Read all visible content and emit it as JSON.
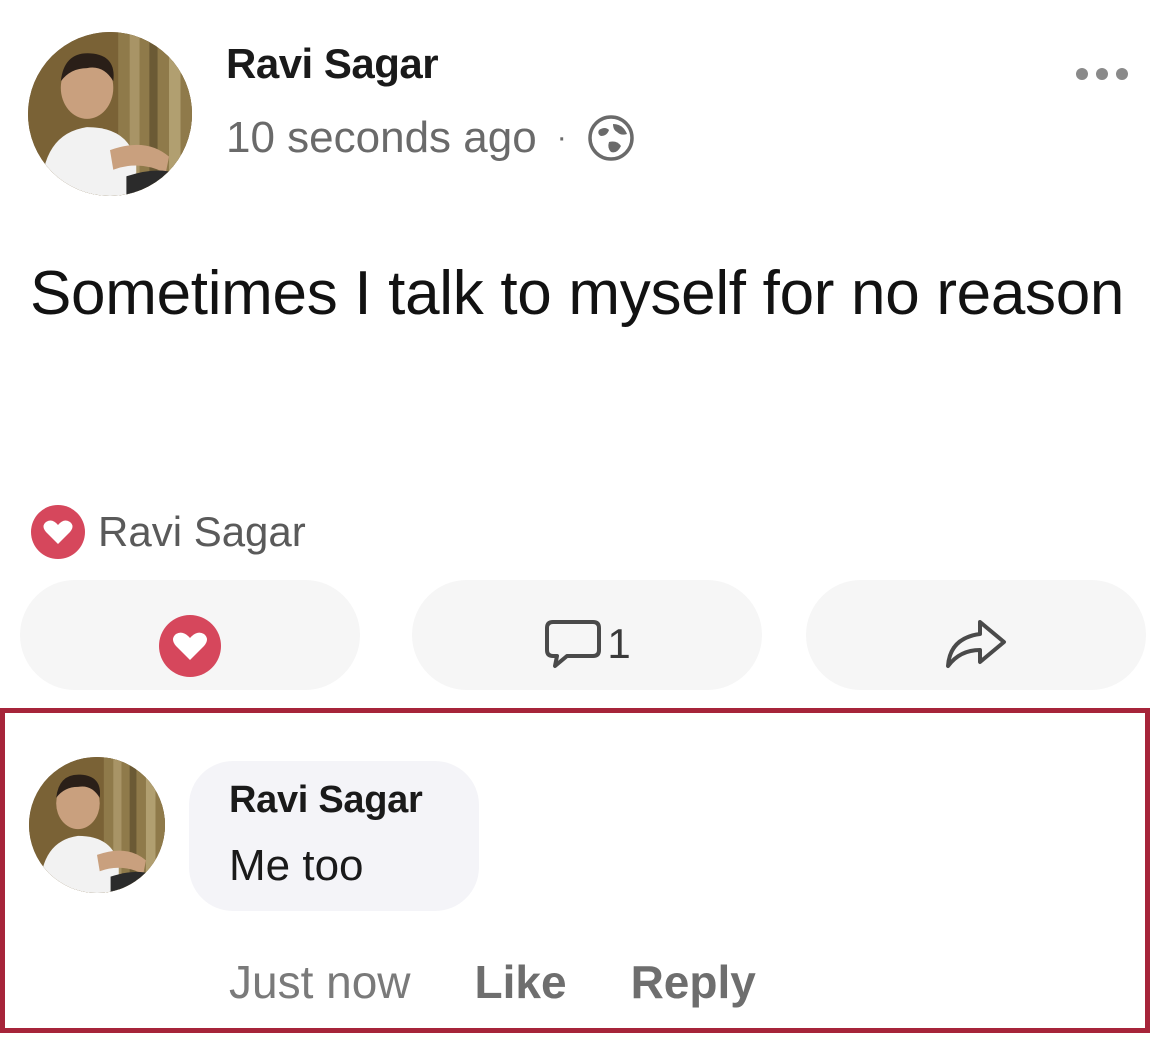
{
  "post": {
    "author": "Ravi Sagar",
    "timestamp": "10 seconds ago",
    "separator": "·",
    "privacy_icon": "globe-icon",
    "more_icon": "more-options-icon",
    "text": "Sometimes I talk to myself for no reason",
    "reactions": {
      "icon": "heart-icon",
      "reactor": "Ravi Sagar"
    },
    "actions": {
      "love_icon": "heart-icon",
      "comment_icon": "comment-icon",
      "comment_count": "1",
      "share_icon": "share-icon"
    }
  },
  "comment": {
    "author": "Ravi Sagar",
    "text": "Me too",
    "time": "Just now",
    "like_label": "Like",
    "reply_label": "Reply"
  },
  "colors": {
    "heart": "#d6475c",
    "highlight_border": "#a6243a",
    "muted_text": "#6a6a6a",
    "pill_bg": "#f6f6f6"
  }
}
